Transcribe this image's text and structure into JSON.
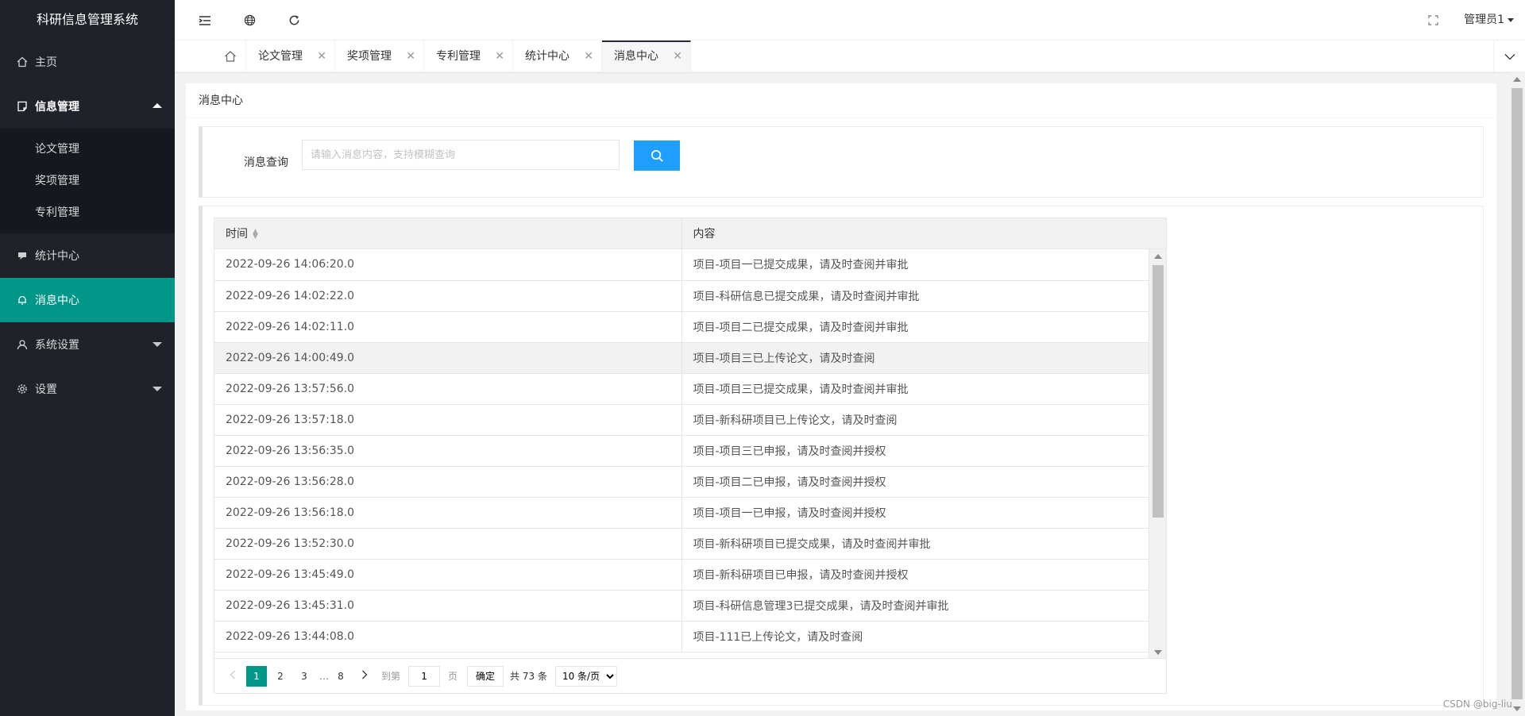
{
  "app": {
    "title": "科研信息管理系统"
  },
  "sidebar": {
    "items": [
      {
        "label": "主页",
        "icon": "home-icon"
      },
      {
        "label": "信息管理",
        "icon": "document-icon",
        "sub": [
          "论文管理",
          "奖项管理",
          "专利管理"
        ]
      },
      {
        "label": "统计中心",
        "icon": "chat-icon"
      },
      {
        "label": "消息中心",
        "icon": "bell-icon"
      },
      {
        "label": "系统设置",
        "icon": "user-icon"
      },
      {
        "label": "设置",
        "icon": "gear-icon"
      }
    ]
  },
  "header": {
    "user": "管理员1"
  },
  "tabs": [
    {
      "label": "论文管理"
    },
    {
      "label": "奖项管理"
    },
    {
      "label": "专利管理"
    },
    {
      "label": "统计中心"
    },
    {
      "label": "消息中心"
    }
  ],
  "main": {
    "title": "消息中心",
    "search": {
      "label": "消息查询",
      "placeholder": "请输入消息内容，支持模糊查询"
    },
    "table": {
      "columns": [
        "时间",
        "内容"
      ],
      "rows": [
        [
          "2022-09-26 14:06:20.0",
          "项目-项目一已提交成果，请及时查阅并审批"
        ],
        [
          "2022-09-26 14:02:22.0",
          "项目-科研信息已提交成果，请及时查阅并审批"
        ],
        [
          "2022-09-26 14:02:11.0",
          "项目-项目二已提交成果，请及时查阅并审批"
        ],
        [
          "2022-09-26 14:00:49.0",
          "项目-项目三已上传论文，请及时查阅"
        ],
        [
          "2022-09-26 13:57:56.0",
          "项目-项目三已提交成果，请及时查阅并审批"
        ],
        [
          "2022-09-26 13:57:18.0",
          "项目-新科研项目已上传论文，请及时查阅"
        ],
        [
          "2022-09-26 13:56:35.0",
          "项目-项目三已申报，请及时查阅并授权"
        ],
        [
          "2022-09-26 13:56:28.0",
          "项目-项目二已申报，请及时查阅并授权"
        ],
        [
          "2022-09-26 13:56:18.0",
          "项目-项目一已申报，请及时查阅并授权"
        ],
        [
          "2022-09-26 13:52:30.0",
          "项目-新科研项目已提交成果，请及时查阅并审批"
        ],
        [
          "2022-09-26 13:45:49.0",
          "项目-新科研项目已申报，请及时查阅并授权"
        ],
        [
          "2022-09-26 13:45:31.0",
          "项目-科研信息管理3已提交成果，请及时查阅并审批"
        ],
        [
          "2022-09-26 13:44:08.0",
          "项目-111已上传论文，请及时查阅"
        ]
      ]
    },
    "pager": {
      "pages": [
        "1",
        "2",
        "3",
        "…",
        "8"
      ],
      "goto_label": "到第",
      "goto_value": "1",
      "page_unit": "页",
      "ok": "确定",
      "total": "共 73 条",
      "page_size": "10 条/页"
    }
  },
  "watermark": "CSDN @big-liu",
  "colors": {
    "accent": "#009688",
    "primary_btn": "#1e9fff",
    "sidebar_bg": "#20222a"
  }
}
